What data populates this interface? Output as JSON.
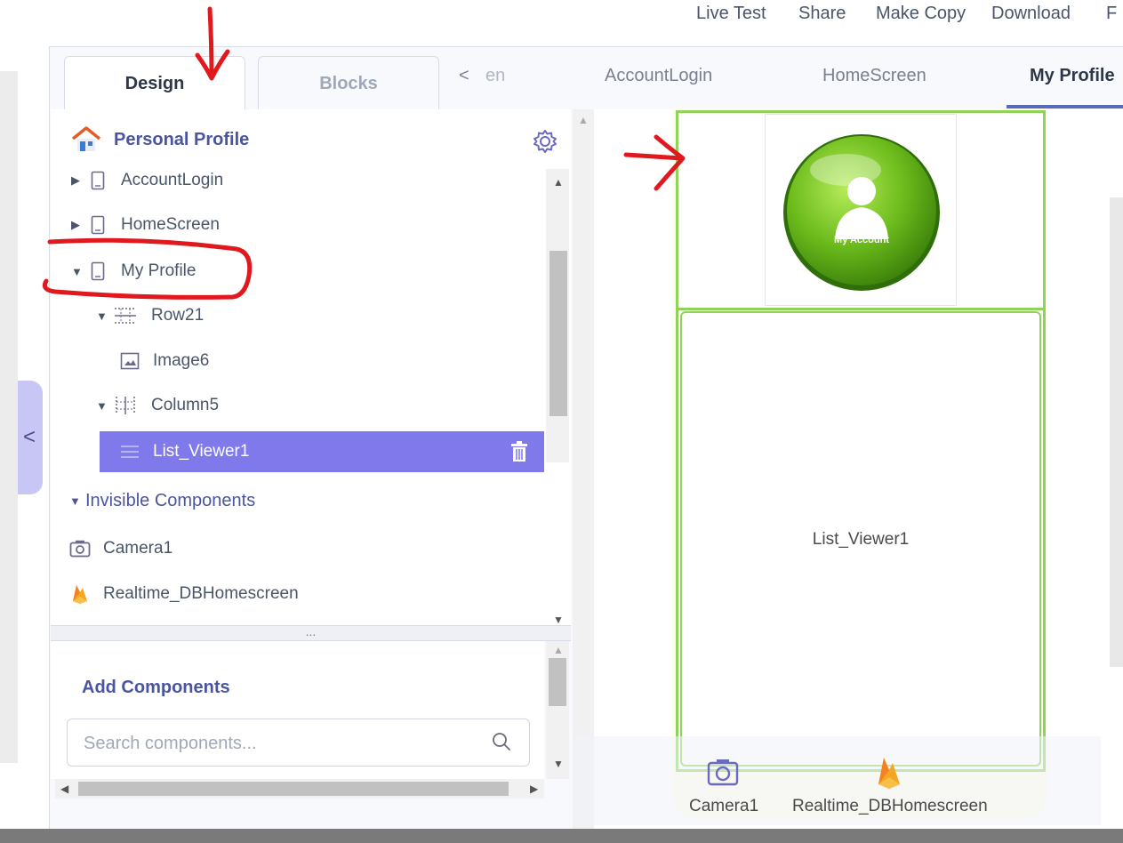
{
  "toolbar": {
    "items": [
      "Live Test",
      "Share",
      "Make Copy",
      "Download",
      "F"
    ]
  },
  "mode_tabs": {
    "design": "Design",
    "blocks": "Blocks"
  },
  "screen_tabs": {
    "scroll_left": "<",
    "partial": "en",
    "items": [
      "AccountLogin",
      "HomeScreen",
      "My Profile"
    ],
    "active": "My Profile"
  },
  "tree": {
    "project_title": "Personal Profile",
    "items": [
      {
        "label": "AccountLogin",
        "icon": "phone-icon",
        "expanded": false
      },
      {
        "label": "HomeScreen",
        "icon": "phone-icon",
        "expanded": false
      },
      {
        "label": "My Profile",
        "icon": "phone-icon",
        "expanded": true
      },
      {
        "label": "Row21",
        "icon": "row-arrangement-icon",
        "expanded": true
      },
      {
        "label": "Image6",
        "icon": "image-icon"
      },
      {
        "label": "Column5",
        "icon": "column-arrangement-icon",
        "expanded": true
      },
      {
        "label": "List_Viewer1",
        "icon": "list-icon",
        "selected": true
      }
    ],
    "invisible_title": "Invisible Components",
    "invisible_items": [
      {
        "label": "Camera1",
        "icon": "camera-icon"
      },
      {
        "label": "Realtime_DBHomescreen",
        "icon": "firebase-icon"
      }
    ]
  },
  "splitter": {
    "grip": "..."
  },
  "add_components": {
    "title": "Add Components",
    "search_placeholder": "Search components..."
  },
  "viewer": {
    "image_text": "My Account",
    "list_label": "List_Viewer1",
    "nonvisible": [
      {
        "label": "Camera1",
        "icon": "camera-icon"
      },
      {
        "label": "Realtime_DBHomescreen",
        "icon": "firebase-icon"
      }
    ]
  },
  "colors": {
    "accent": "#7f79ec",
    "arrangement_border": "#8fd35a",
    "title_blue": "#4a55a0",
    "annotation_red": "#e0191f"
  }
}
